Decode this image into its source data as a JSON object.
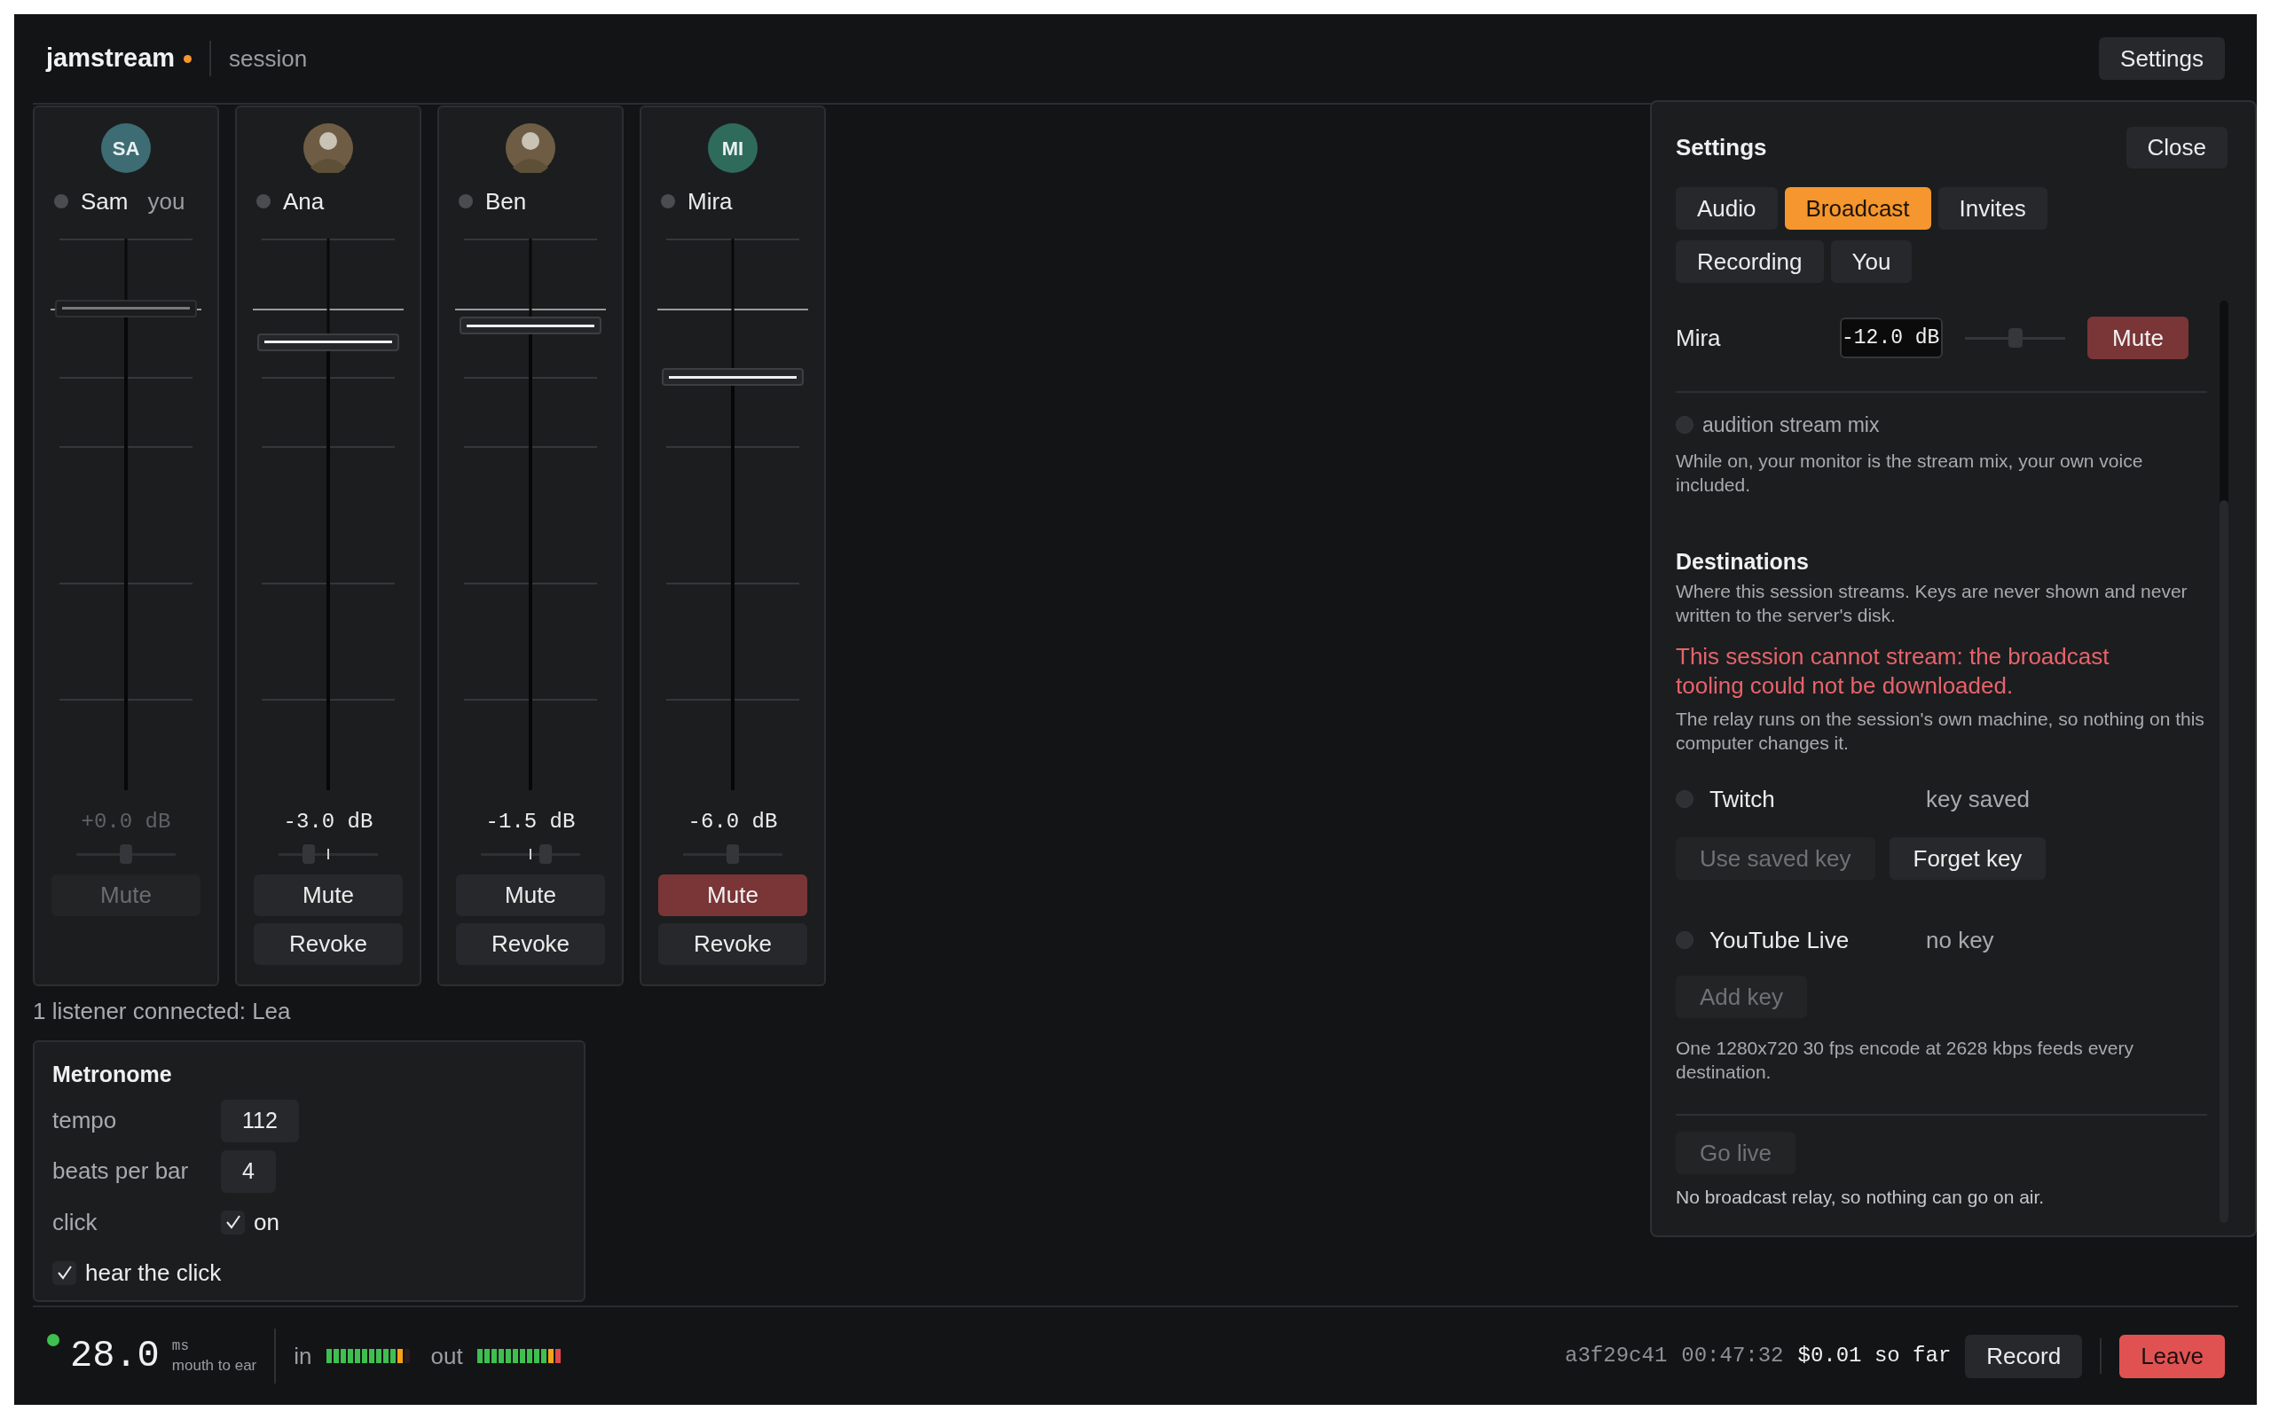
{
  "header": {
    "logo": "jamstream",
    "context": "session",
    "settings_button": "Settings"
  },
  "channels": [
    {
      "name": "Sam",
      "tag": "you",
      "avatar": {
        "kind": "initials",
        "initials": "SA",
        "color": "#3d6c74"
      },
      "disabled": true,
      "fader": {
        "level": 0.873
      },
      "reading": "+0.0 dB",
      "pan": {
        "level": 0.5
      },
      "mute": {
        "label": "Mute",
        "muted": false
      }
    },
    {
      "name": "Ana",
      "avatar": {
        "kind": "photo"
      },
      "disabled": false,
      "fader": {
        "level": 0.812
      },
      "reading": "-3.0 dB",
      "pan": {
        "level": 0.3
      },
      "mute": {
        "label": "Mute",
        "muted": false
      },
      "revoke": "Revoke"
    },
    {
      "name": "Ben",
      "avatar": {
        "kind": "photo"
      },
      "disabled": false,
      "fader": {
        "level": 0.842
      },
      "reading": "-1.5 dB",
      "pan": {
        "level": 0.65
      },
      "mute": {
        "label": "Mute",
        "muted": false
      },
      "revoke": "Revoke"
    },
    {
      "name": "Mira",
      "avatar": {
        "kind": "initials",
        "initials": "MI",
        "color": "#2f6b5a"
      },
      "disabled": false,
      "fader": {
        "level": 0.749
      },
      "reading": "-6.0 dB",
      "pan": {
        "level": 0.5
      },
      "mute": {
        "label": "Mute",
        "muted": true
      },
      "revoke": "Revoke"
    }
  ],
  "listeners": "1 listener connected: Lea",
  "metronome": {
    "title": "Metronome",
    "fields": [
      {
        "label": "tempo",
        "value": "112"
      },
      {
        "label": "beats per bar",
        "value": "4"
      }
    ],
    "click": {
      "label": "click",
      "checked": true,
      "text": "on"
    },
    "hear_click": {
      "label": "hear the click",
      "checked": true
    }
  },
  "settings": {
    "title": "Settings",
    "close": "Close",
    "tabs": [
      {
        "label": "Audio",
        "selected": false
      },
      {
        "label": "Broadcast",
        "selected": true
      },
      {
        "label": "Invites",
        "selected": false
      },
      {
        "label": "Recording",
        "selected": false
      },
      {
        "label": "You",
        "selected": false
      }
    ],
    "mix_row": {
      "name": "Mira",
      "value": "-12.0 dB",
      "level": 0.5,
      "mute": {
        "label": "Mute",
        "muted": true
      }
    },
    "audition": {
      "label": "audition stream mix",
      "on": false
    },
    "audition_note": "While on, your monitor is the stream mix, your own voice included.",
    "destinations": {
      "title": "Destinations",
      "note": "Where this session streams. Keys are never shown and never written to the server's disk.",
      "error": "This session cannot stream: the broadcast tooling could not be downloaded.",
      "relay_note": "The relay runs on the session's own machine, so nothing on this computer changes it.",
      "items": [
        {
          "name": "Twitch",
          "on": false,
          "status": "key saved",
          "buttons": [
            {
              "label": "Use saved key",
              "disabled": true
            },
            {
              "label": "Forget key",
              "disabled": false
            }
          ]
        },
        {
          "name": "YouTube Live",
          "on": false,
          "status": "no key",
          "buttons": [
            {
              "label": "Add key",
              "disabled": true
            }
          ]
        }
      ],
      "encode_note": "One 1280x720 30 fps encode at 2628 kbps feeds every destination."
    },
    "go_live": {
      "label": "Go live",
      "disabled": true
    },
    "air_note": "No broadcast relay, so nothing can go on air."
  },
  "status_bar": {
    "latency": {
      "online": true,
      "value": "28.0",
      "unit": "ms",
      "caption": "mouth to ear"
    },
    "meters": [
      {
        "label": "in",
        "level": 0.92
      },
      {
        "label": "out",
        "level": 1.0
      }
    ],
    "session_id": "a3f29c41",
    "elapsed": "00:47:32",
    "cost": "$0.01 so far",
    "record": "Record",
    "leave": "Leave"
  }
}
